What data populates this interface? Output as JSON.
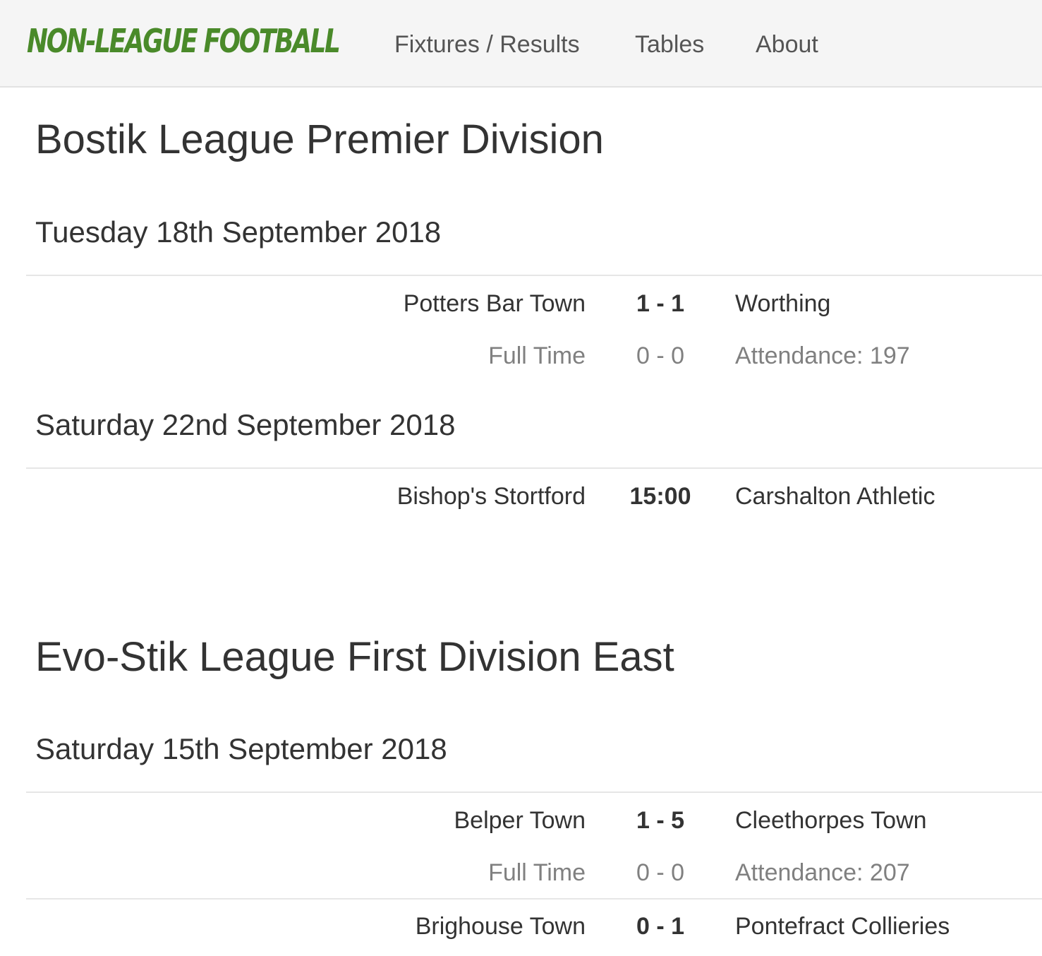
{
  "brand": "Non-League Football",
  "nav": {
    "fixtures": "Fixtures / Results",
    "tables": "Tables",
    "about": "About"
  },
  "leagues": [
    {
      "title": "Bostik League Premier Division",
      "days": [
        {
          "date": "Tuesday 18th September 2018",
          "matches": [
            {
              "home": "Potters Bar Town",
              "score": "1 - 1",
              "away": "Worthing",
              "status": "Full Time",
              "half_time": "0 - 0",
              "attendance": "Attendance: 197"
            }
          ]
        },
        {
          "date": "Saturday 22nd September 2018",
          "matches": [
            {
              "home": "Bishop's Stortford",
              "score": "15:00",
              "away": "Carshalton Athletic"
            }
          ]
        }
      ]
    },
    {
      "title": "Evo-Stik League First Division East",
      "days": [
        {
          "date": "Saturday 15th September 2018",
          "matches": [
            {
              "home": "Belper Town",
              "score": "1 - 5",
              "away": "Cleethorpes Town",
              "status": "Full Time",
              "half_time": "0 - 0",
              "attendance": "Attendance: 207"
            },
            {
              "home": "Brighouse Town",
              "score": "0 - 1",
              "away": "Pontefract Collieries"
            }
          ]
        }
      ]
    }
  ]
}
